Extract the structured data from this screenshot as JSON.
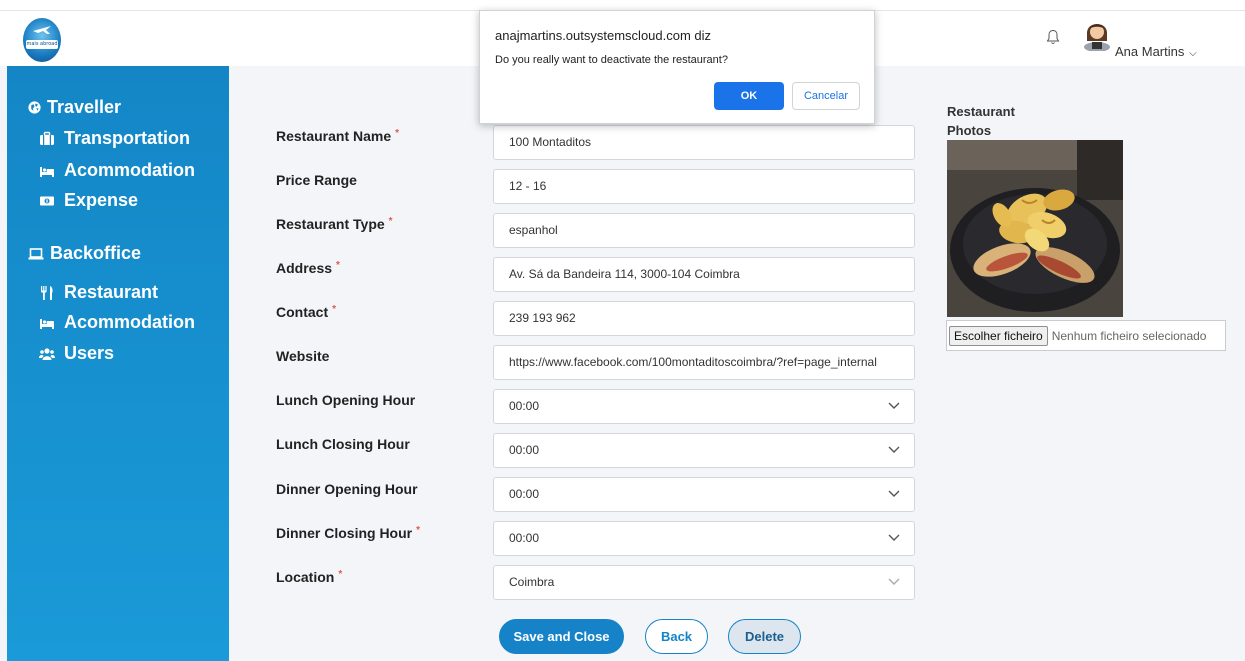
{
  "header": {
    "logo_text": "mais abroad",
    "user_name": "Ana Martins"
  },
  "sidebar": {
    "traveller": {
      "label": "Traveller",
      "items": [
        {
          "label": "Transportation",
          "icon": "briefcase-icon"
        },
        {
          "label": "Acommodation",
          "icon": "bed-icon"
        },
        {
          "label": "Expense",
          "icon": "money-bill-icon"
        }
      ]
    },
    "backoffice": {
      "label": "Backoffice",
      "items": [
        {
          "label": "Restaurant",
          "icon": "utensils-icon"
        },
        {
          "label": "Acommodation",
          "icon": "bed-icon"
        },
        {
          "label": "Users",
          "icon": "users-icon"
        }
      ]
    }
  },
  "form": {
    "fields": [
      {
        "label": "Restaurant Name",
        "required": true,
        "value": "100 Montaditos",
        "type": "text"
      },
      {
        "label": "Price Range",
        "required": false,
        "value": "12 - 16",
        "type": "text"
      },
      {
        "label": "Restaurant Type",
        "required": true,
        "value": "espanhol",
        "type": "text"
      },
      {
        "label": "Address",
        "required": true,
        "value": "Av. Sá da Bandeira 114, 3000-104 Coimbra",
        "type": "text"
      },
      {
        "label": "Contact",
        "required": true,
        "value": "239 193 962",
        "type": "text"
      },
      {
        "label": "Website",
        "required": false,
        "value": "https://www.facebook.com/100montaditoscoimbra/?ref=page_internal",
        "type": "text"
      },
      {
        "label": "Lunch Opening Hour",
        "required": false,
        "value": "00:00",
        "type": "select"
      },
      {
        "label": "Lunch Closing Hour",
        "required": false,
        "value": "00:00",
        "type": "select"
      },
      {
        "label": "Dinner Opening Hour",
        "required": false,
        "value": "00:00",
        "type": "select"
      },
      {
        "label": "Dinner Closing Hour",
        "required": true,
        "value": "00:00",
        "type": "select"
      },
      {
        "label": "Location",
        "required": true,
        "value": "Coimbra",
        "type": "select"
      }
    ],
    "required_mark": "*"
  },
  "photos": {
    "label": "Restaurant Photos",
    "file_button": "Escolher ficheiro",
    "file_status": "Nenhum ficheiro selecionado"
  },
  "actions": {
    "save_label": "Save and Close",
    "back_label": "Back",
    "delete_label": "Delete"
  },
  "dialog": {
    "title": "anajmartins.outsystemscloud.com diz",
    "message": "Do you really want to deactivate the restaurant?",
    "ok_label": "OK",
    "cancel_label": "Cancelar"
  },
  "colors": {
    "sidebar": "#1486c6",
    "primary": "#1683c8",
    "required": "#e05a4f",
    "dialog_ok": "#1a73e8"
  }
}
